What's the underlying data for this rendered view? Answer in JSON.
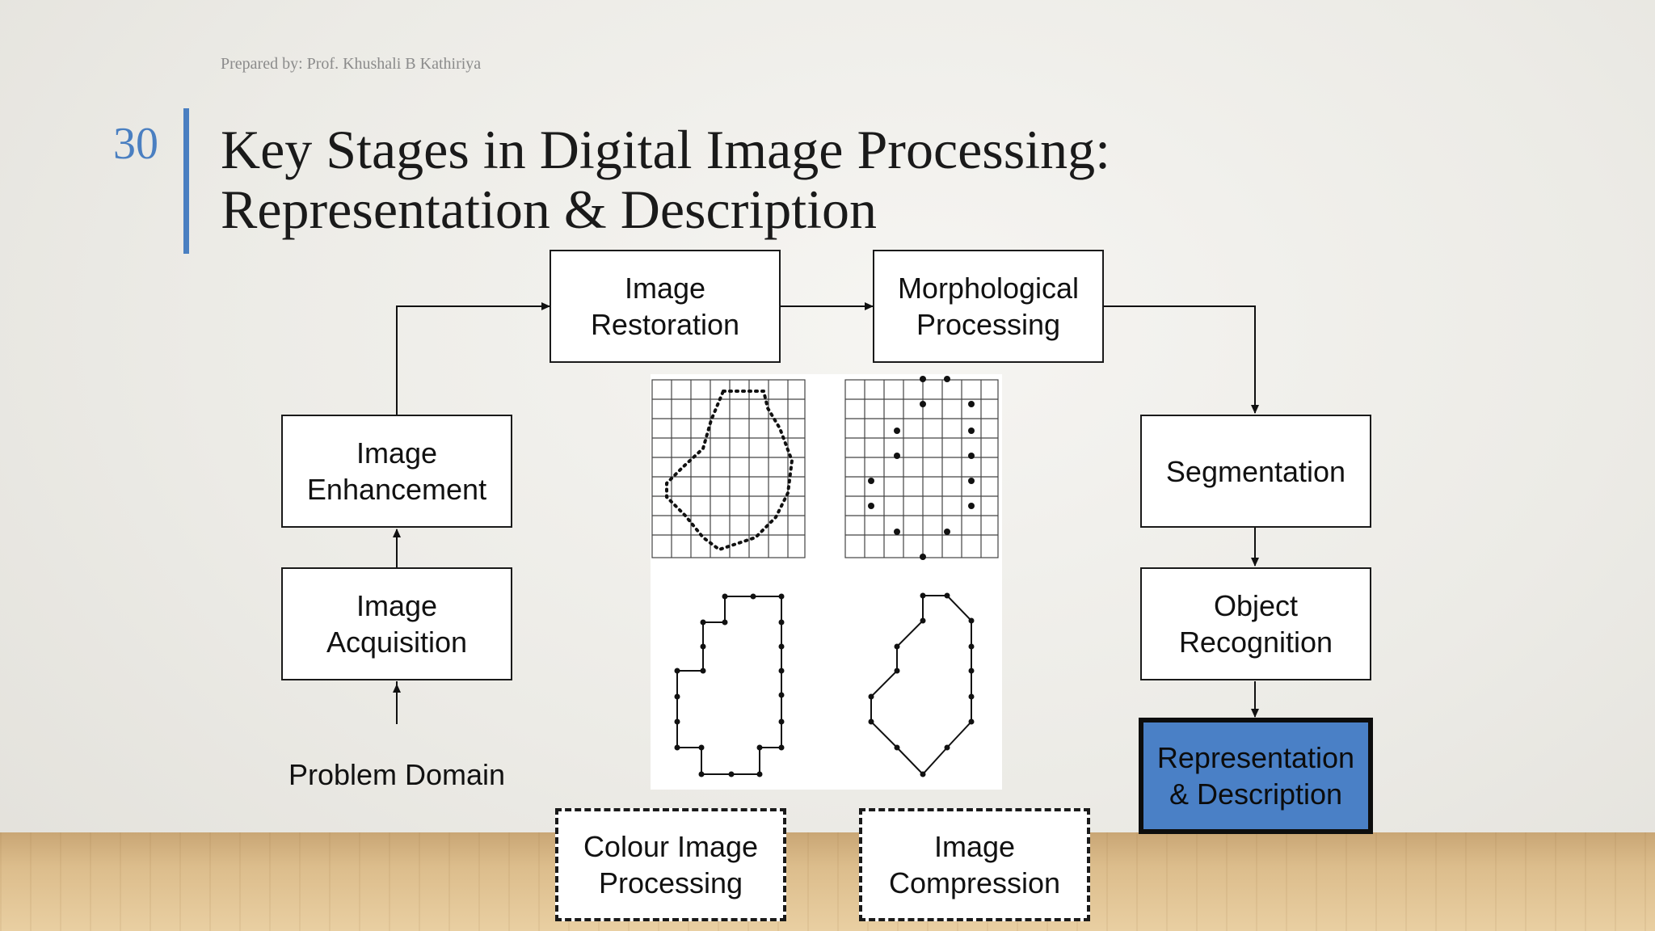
{
  "header": {
    "prepared_by": "Prepared by: Prof. Khushali B Kathiriya",
    "slide_number": "30",
    "title_line1": "Key Stages in Digital Image Processing:",
    "title_line2": "Representation & Description"
  },
  "diagram": {
    "stages": {
      "image_restoration": "Image\nRestoration",
      "morphological_processing": "Morphological\nProcessing",
      "image_enhancement": "Image\nEnhancement",
      "image_acquisition": "Image\nAcquisition",
      "segmentation": "Segmentation",
      "object_recognition": "Object\nRecognition",
      "representation_description": "Representation\n& Description",
      "colour_image_processing": "Colour Image\nProcessing",
      "image_compression": "Image\nCompression"
    },
    "problem_domain": "Problem Domain",
    "highlighted_stage": "Representation & Description",
    "highlight_color": "#4a80c6",
    "accent_color": "#4a7fc1"
  }
}
